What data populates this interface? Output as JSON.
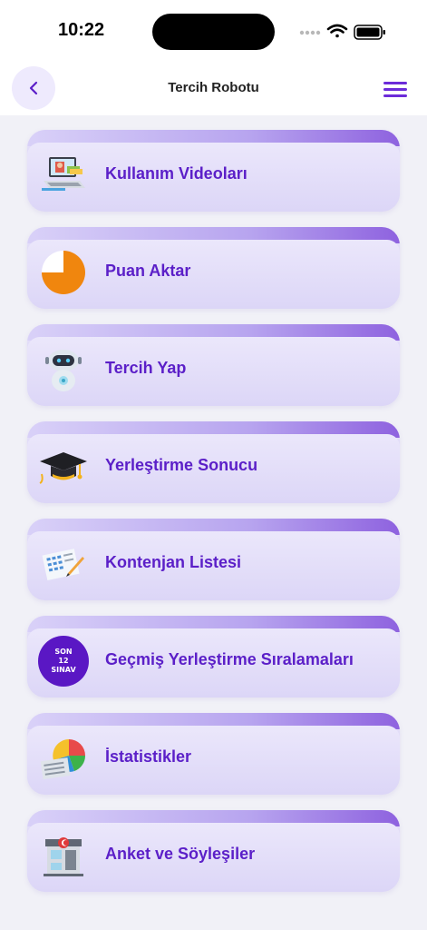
{
  "status_bar": {
    "time": "10:22",
    "icons": [
      "signal-dots-icon",
      "wifi-icon",
      "battery-icon"
    ]
  },
  "nav": {
    "title": "Tercih Robotu",
    "back_icon": "chevron-left-icon",
    "menu_icon": "hamburger-menu-icon"
  },
  "colors": {
    "accent": "#5b1fc8",
    "card_gradient_start": "#d9d1f8",
    "card_gradient_end": "#8e62df",
    "background": "#f1f1f7"
  },
  "menu_items": [
    {
      "label": "Kullanım Videoları",
      "icon": "video-tutorial-icon"
    },
    {
      "label": "Puan Aktar",
      "icon": "pie-chart-icon"
    },
    {
      "label": "Tercih Yap",
      "icon": "robot-icon"
    },
    {
      "label": "Yerleştirme Sonucu",
      "icon": "graduation-cap-icon"
    },
    {
      "label": "Kontenjan Listesi",
      "icon": "checklist-icon"
    },
    {
      "label": "Geçmiş Yerleştirme Sıralamaları",
      "icon": "son-12-sinav-badge-icon",
      "badge": {
        "line1": "SON",
        "line2": "12",
        "line3": "SINAV"
      }
    },
    {
      "label": "İstatistikler",
      "icon": "statistics-icon"
    },
    {
      "label": "Anket ve Söyleşiler",
      "icon": "kiosk-icon"
    }
  ]
}
